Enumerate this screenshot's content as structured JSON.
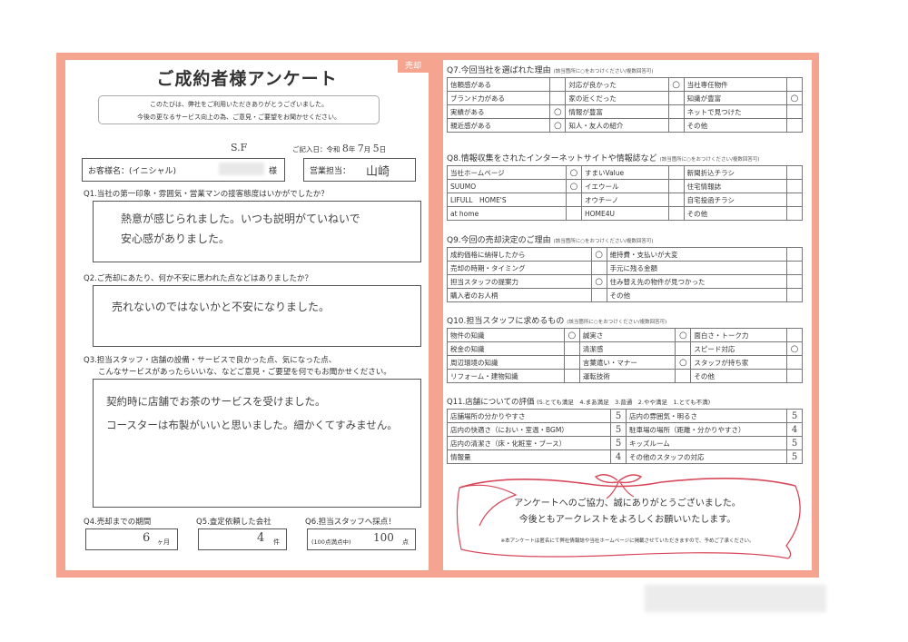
{
  "header": {
    "title": "ご成約者様アンケート",
    "tag": "売却",
    "intro1": "このたびは、弊社をご利用いただきありがとうございました。",
    "intro2": "今後の更なるサービス向上の為、ご意見・ご要望をお聞かせください。"
  },
  "date": {
    "label": "ご記入日：令和",
    "year": "8",
    "y": "年",
    "month": "7",
    "m": "月",
    "day": "5",
    "d": "日"
  },
  "customer": {
    "initials": "S.F",
    "label": "お客様名：(イニシャル)",
    "suffix": "様",
    "staff_label": "営業担当：",
    "staff_value": "山崎"
  },
  "q1": {
    "q": "Q1.当社の第一印象・雰囲気・営業マンの接客態度はいかがでしたか？",
    "a1": "熱意が感じられました。いつも説明がていねいで",
    "a2": "安心感がありました。"
  },
  "q2": {
    "q": "Q2.ご売却にあたり、何か不安に思われた点などはありましたか？",
    "a1": "売れないのではないかと不安になりました。"
  },
  "q3": {
    "q1": "Q3.担当スタッフ・店舗の設備・サービスで良かった点、気になった点、",
    "q2": "こんなサービスがあったらいいな、などご意見・ご要望を何でもお聞かせください。",
    "a1": "契約時に店舗でお茶のサービスを受けました。",
    "a2": "コースターは布製がいいと思いました。細かくてすみません。"
  },
  "q4": {
    "q": "Q4.売却までの期間",
    "value": "6",
    "unit": "ヶ月"
  },
  "q5": {
    "q": "Q5.査定依頼した会社",
    "value": "4",
    "unit": "件"
  },
  "q6": {
    "q": "Q6.担当スタッフへ採点！",
    "note": "(100点満点中)",
    "value": "100",
    "unit": "点"
  },
  "q7": {
    "title": "Q7.今回当社を選ばれた理由",
    "note": "(該当箇所に○をおつけください/複数回答可)",
    "rows": [
      [
        "信頼感がある",
        "",
        "対応が良かった",
        "○",
        "当社専任物件",
        ""
      ],
      [
        "ブランド力がある",
        "",
        "家の近くだった",
        "",
        "知識が豊富",
        "○"
      ],
      [
        "実績がある",
        "○",
        "情報が豊富",
        "",
        "ネットで見つけた",
        ""
      ],
      [
        "親近感がある",
        "○",
        "知人・友人の紹介",
        "",
        "その他",
        ""
      ]
    ]
  },
  "q8": {
    "title": "Q8.情報収集をされたインターネットサイトや情報誌など",
    "note": "(該当箇所に○をおつけください/複数回答可)",
    "rows": [
      [
        "当社ホームページ",
        "○",
        "すまいValue",
        "",
        "新聞折込チラシ",
        ""
      ],
      [
        "SUUMO",
        "○",
        "イエウール",
        "",
        "住宅情報誌",
        ""
      ],
      [
        "LIFULL　HOME'S",
        "",
        "オウチーノ",
        "",
        "自宅投函チラシ",
        ""
      ],
      [
        "at home",
        "",
        "HOME4U",
        "",
        "その他",
        ""
      ]
    ]
  },
  "q9": {
    "title": "Q9.今回の売却決定のご理由",
    "note": "(該当箇所に○をおつけください/複数回答可)",
    "rows": [
      [
        "成約価格に納得したから",
        "○",
        "維持費・支払いが大変",
        ""
      ],
      [
        "売却の時期・タイミング",
        "",
        "手元に残る金額",
        ""
      ],
      [
        "担当スタッフの提案力",
        "○",
        "住み替え先の物件が見つかった",
        ""
      ],
      [
        "購入者のお人柄",
        "",
        "その他",
        ""
      ]
    ]
  },
  "q10": {
    "title": "Q10.担当スタッフに求めるもの",
    "note": "(該当箇所に○をおつけください/複数回答可)",
    "rows": [
      [
        "物件の知識",
        "○",
        "誠実さ",
        "○",
        "面白さ・トーク力",
        ""
      ],
      [
        "税金の知識",
        "",
        "清潔感",
        "",
        "スピード対応",
        "○"
      ],
      [
        "周辺環境の知識",
        "",
        "言葉遣い・マナー",
        "○",
        "スタッフが持ち家",
        ""
      ],
      [
        "リフォーム・建物知識",
        "",
        "運転技術",
        "",
        "その他",
        ""
      ]
    ]
  },
  "q11": {
    "title": "Q11.店舗についての評価",
    "scale": "(5.とても満足　4.まあ満足　3.普通　2.やや満足　1.とても不満)",
    "rows": [
      [
        "店舗場所の分かりやすさ",
        "5",
        "店内の雰囲気・明るさ",
        "5"
      ],
      [
        "店内の快適さ（におい・室温・BGM）",
        "5",
        "駐車場の場所（距離・分かりやすさ）",
        "4"
      ],
      [
        "店内の清潔さ（床・化粧室・ブース）",
        "5",
        "キッズルーム",
        "5"
      ],
      [
        "情報量",
        "4",
        "その他のスタッフの対応",
        "5"
      ]
    ]
  },
  "thanks": {
    "l1": "アンケートへのご協力、誠にありがとうございました。",
    "l2": "今後ともアークレストをよろしくお願いいたします。",
    "foot": "※本アンケートは匿名にて弊社情報誌や当社ホームページに掲載させていただきますので、予めご了承ください。"
  },
  "colors": {
    "frame": "#f5a58f",
    "ribbon": "#d8485a"
  }
}
